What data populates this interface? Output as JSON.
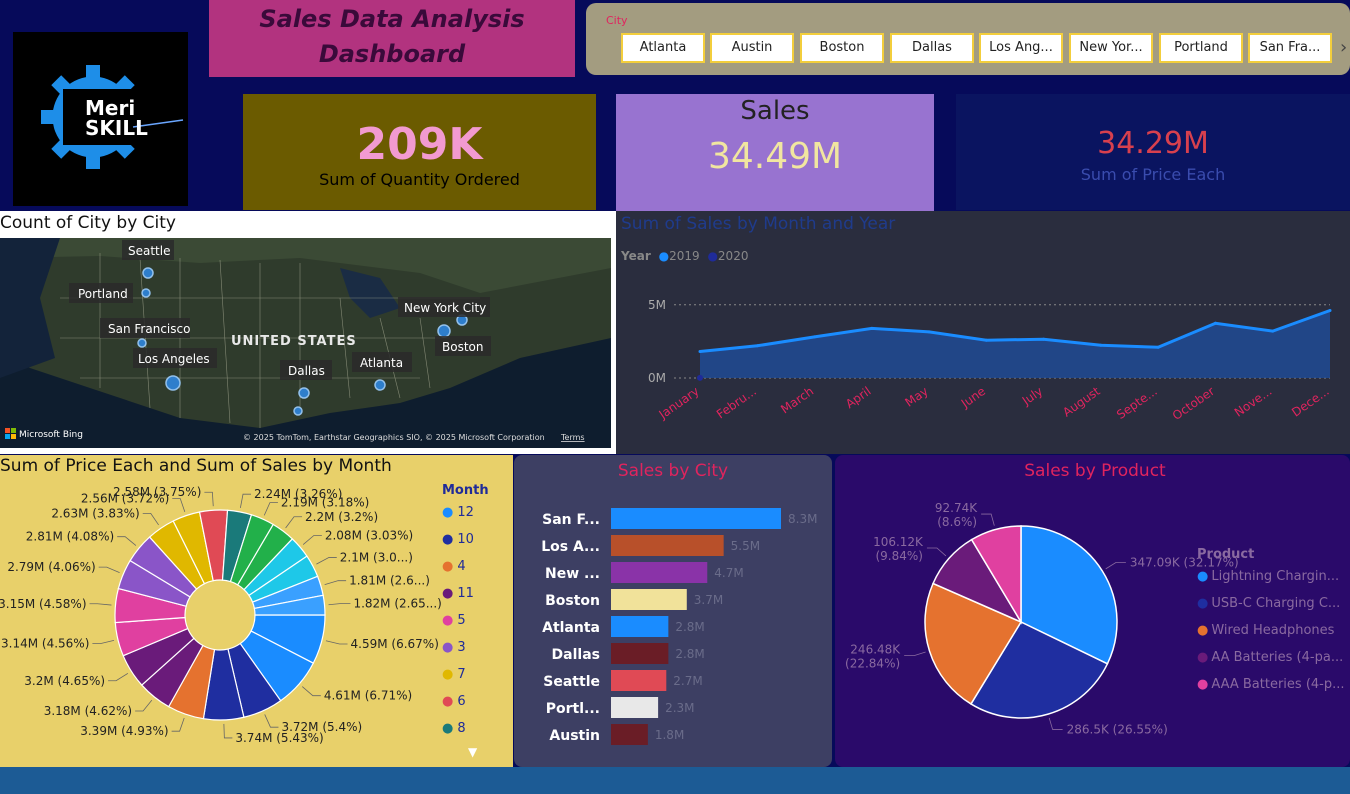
{
  "header": {
    "title_line1": "Sales Data Analysis",
    "title_line2": "Dashboard",
    "logo_text_1": "Meri",
    "logo_text_2": "SKILL"
  },
  "slicer": {
    "label": "City",
    "options": [
      "Atlanta",
      "Austin",
      "Boston",
      "Dallas",
      "Los Ang...",
      "New Yor...",
      "Portland",
      "San Fra..."
    ]
  },
  "cards": {
    "quantity": {
      "value": "209K",
      "label": "Sum of Quantity Ordered"
    },
    "sales": {
      "title": "Sales",
      "value": "34.49M"
    },
    "price": {
      "value": "34.29M",
      "label": "Sum of Price Each"
    }
  },
  "map": {
    "title": "Count of City by City",
    "country_label": "UNITED STATES",
    "cities": [
      "Seattle",
      "Portland",
      "San Francisco",
      "Los Angeles",
      "Dallas",
      "Atlanta",
      "New York City",
      "Boston"
    ],
    "brand": "Microsoft Bing",
    "credit": "© 2025 TomTom, Earthstar Geographics SIO, © 2025 Microsoft Corporation",
    "terms": "Terms"
  },
  "colors": {
    "s2019": "#1a8cff",
    "s2020": "#1f2b99",
    "accent_red": "#e0245e"
  },
  "chart_data": [
    {
      "type": "area",
      "title": "Sum of Sales by Month and Year",
      "legend_title": "Year",
      "legend_position": "top-left",
      "categories": [
        "January",
        "Febru...",
        "March",
        "April",
        "May",
        "June",
        "July",
        "August",
        "Septe...",
        "October",
        "Nove...",
        "Dece..."
      ],
      "series": [
        {
          "name": "2019",
          "values": [
            1.81,
            2.2,
            2.81,
            3.39,
            3.15,
            2.58,
            2.65,
            2.24,
            2.1,
            3.74,
            3.2,
            4.61
          ]
        },
        {
          "name": "2020",
          "values": [
            0.01
          ]
        }
      ],
      "ytick_labels": [
        "5M",
        "0M"
      ],
      "yticks": [
        5,
        0
      ],
      "ylim": [
        0,
        5.6
      ],
      "grid": true
    },
    {
      "type": "pie",
      "title": "Sum of Price Each and Sum of Sales by Month",
      "legend_title": "Month",
      "legend_position": "right",
      "legend": [
        "12",
        "10",
        "4",
        "11",
        "5",
        "3",
        "7",
        "6",
        "8"
      ],
      "slices": [
        {
          "label": "4.59M (6.67%)",
          "value": 4.59
        },
        {
          "label": "4.61M (6.71%)",
          "value": 4.61
        },
        {
          "label": "3.72M (5.4%)",
          "value": 3.72
        },
        {
          "label": "3.74M (5.43%)",
          "value": 3.74
        },
        {
          "label": "3.39M (4.93%)",
          "value": 3.39
        },
        {
          "label": "3.18M (4.62%)",
          "value": 3.18
        },
        {
          "label": "3.2M (4.65%)",
          "value": 3.2
        },
        {
          "label": "3.14M (4.56%)",
          "value": 3.14
        },
        {
          "label": "3.15M (4.58%)",
          "value": 3.15
        },
        {
          "label": "2.79M (4.06%)",
          "value": 2.79
        },
        {
          "label": "2.81M (4.08%)",
          "value": 2.81
        },
        {
          "label": "2.63M (3.83%)",
          "value": 2.63
        },
        {
          "label": "2.56M (3.72%)",
          "value": 2.56
        },
        {
          "label": "2.58M (3.75%)",
          "value": 2.58
        },
        {
          "label": "2.24M (3.26%)",
          "value": 2.24
        },
        {
          "label": "2.19M (3.18%)",
          "value": 2.19
        },
        {
          "label": "2.2M (3.2%)",
          "value": 2.2
        },
        {
          "label": "2.08M (3.03%)",
          "value": 2.08
        },
        {
          "label": "2.1M (3.0...)",
          "value": 2.1
        },
        {
          "label": "1.81M (2.6...)",
          "value": 1.81
        },
        {
          "label": "1.82M (2.65...)",
          "value": 1.82
        }
      ]
    },
    {
      "type": "bar",
      "title": "Sales by City",
      "categories": [
        "San F...",
        "Los A...",
        "New ...",
        "Boston",
        "Atlanta",
        "Dallas",
        "Seattle",
        "Portl...",
        "Austin"
      ],
      "values": [
        8.3,
        5.5,
        4.7,
        3.7,
        2.8,
        2.8,
        2.7,
        2.3,
        1.8
      ],
      "data_labels": [
        "8.3M",
        "5.5M",
        "4.7M",
        "3.7M",
        "2.8M",
        "2.8M",
        "2.7M",
        "2.3M",
        "1.8M"
      ],
      "bar_colors": [
        "#1a8cff",
        "#b8502a",
        "#8a33a8",
        "#f1e29a",
        "#1a8cff",
        "#6a1d26",
        "#e04a55",
        "#e8e8e8",
        "#6a1d26"
      ]
    },
    {
      "type": "pie",
      "title": "Sales by Product",
      "legend_title": "Product",
      "legend_position": "right",
      "slices": [
        {
          "name": "Lightning Chargin...",
          "value": 347.09,
          "label_1": "347.09K (32.17%)",
          "label_2": "",
          "color": "#1a8cff"
        },
        {
          "name": "USB-C Charging C...",
          "value": 286.5,
          "label_1": "286.5K (26.55%)",
          "label_2": "",
          "color": "#1f2ea0"
        },
        {
          "name": "Wired Headphones",
          "value": 246.48,
          "label_1": "246.48K",
          "label_2": "(22.84%)",
          "color": "#e5722f"
        },
        {
          "name": "AA Batteries (4-pa...",
          "value": 106.12,
          "label_1": "106.12K",
          "label_2": "(9.84%)",
          "color": "#6a1b7a"
        },
        {
          "name": "AAA Batteries (4-p...",
          "value": 92.74,
          "label_1": "92.74K",
          "label_2": "(8.6%)",
          "color": "#e040a0"
        }
      ]
    }
  ]
}
